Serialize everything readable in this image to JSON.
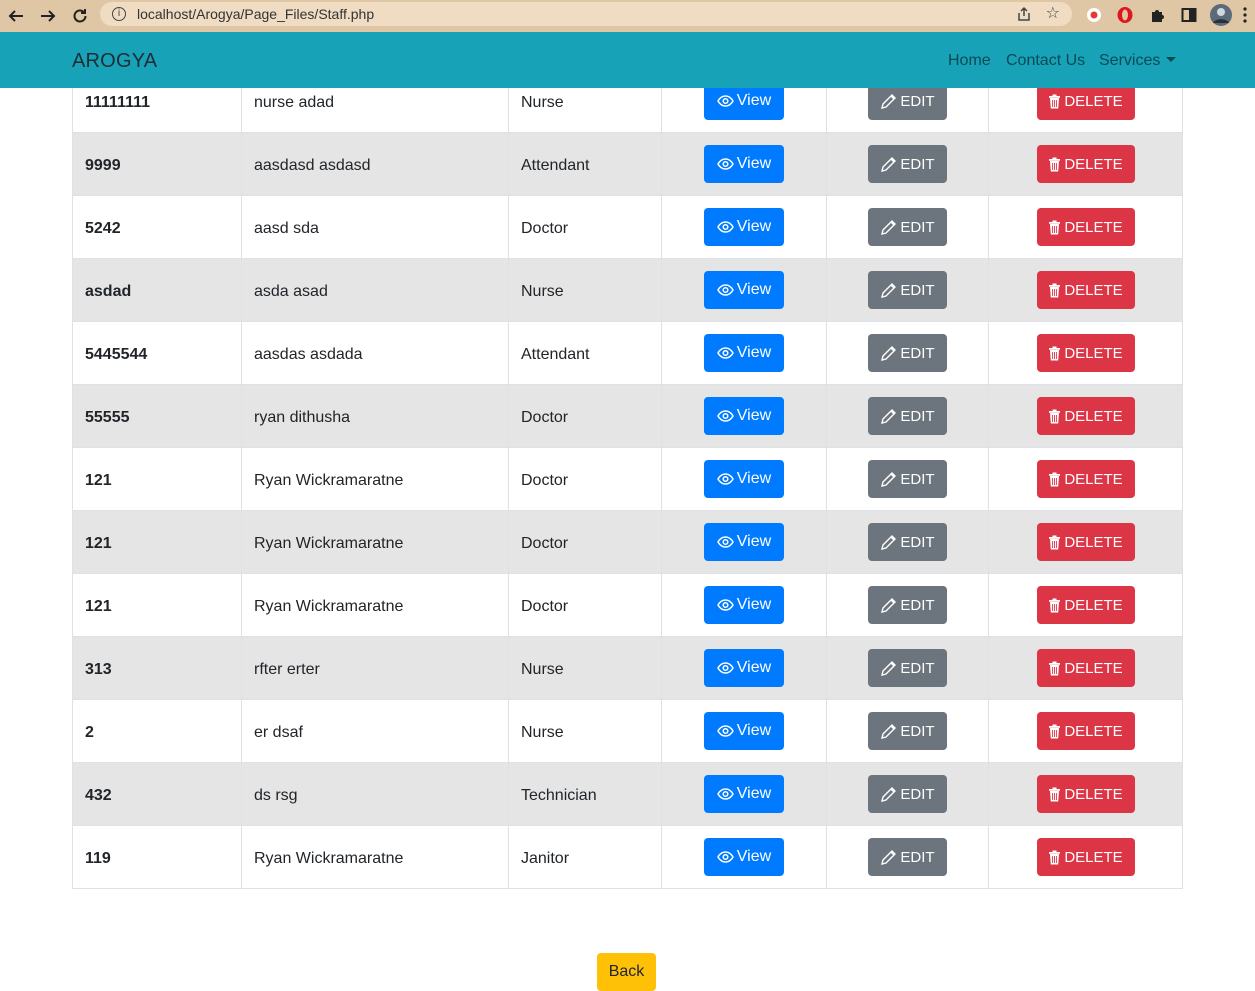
{
  "browser": {
    "url": "localhost/Arogya/Page_Files/Staff.php"
  },
  "navbar": {
    "brand": "AROGYA",
    "links": [
      "Home",
      "Contact Us",
      "Services"
    ]
  },
  "table": {
    "view_label": "View",
    "edit_label": "EDIT",
    "delete_label": "DELETE",
    "rows": [
      {
        "id": "11111111",
        "name": "nurse adad",
        "role": "Nurse"
      },
      {
        "id": "9999",
        "name": "aasdasd asdasd",
        "role": "Attendant"
      },
      {
        "id": "5242",
        "name": "aasd sda",
        "role": "Doctor"
      },
      {
        "id": "asdad",
        "name": "asda asad",
        "role": "Nurse"
      },
      {
        "id": "5445544",
        "name": "aasdas asdada",
        "role": "Attendant"
      },
      {
        "id": "55555",
        "name": "ryan dithusha",
        "role": "Doctor"
      },
      {
        "id": "121",
        "name": "Ryan Wickramaratne",
        "role": "Doctor"
      },
      {
        "id": "121",
        "name": "Ryan Wickramaratne",
        "role": "Doctor"
      },
      {
        "id": "121",
        "name": "Ryan Wickramaratne",
        "role": "Doctor"
      },
      {
        "id": "313",
        "name": "rfter erter",
        "role": "Nurse"
      },
      {
        "id": "2",
        "name": "er dsaf",
        "role": "Nurse"
      },
      {
        "id": "432",
        "name": "ds rsg",
        "role": "Technician"
      },
      {
        "id": "119",
        "name": "Ryan Wickramaratne",
        "role": "Janitor"
      }
    ]
  },
  "back_label": "Back",
  "colors": {
    "navbar": "#17a2b8",
    "view": "#007bff",
    "edit": "#6c757d",
    "delete": "#dc3545",
    "back": "#ffc107"
  }
}
